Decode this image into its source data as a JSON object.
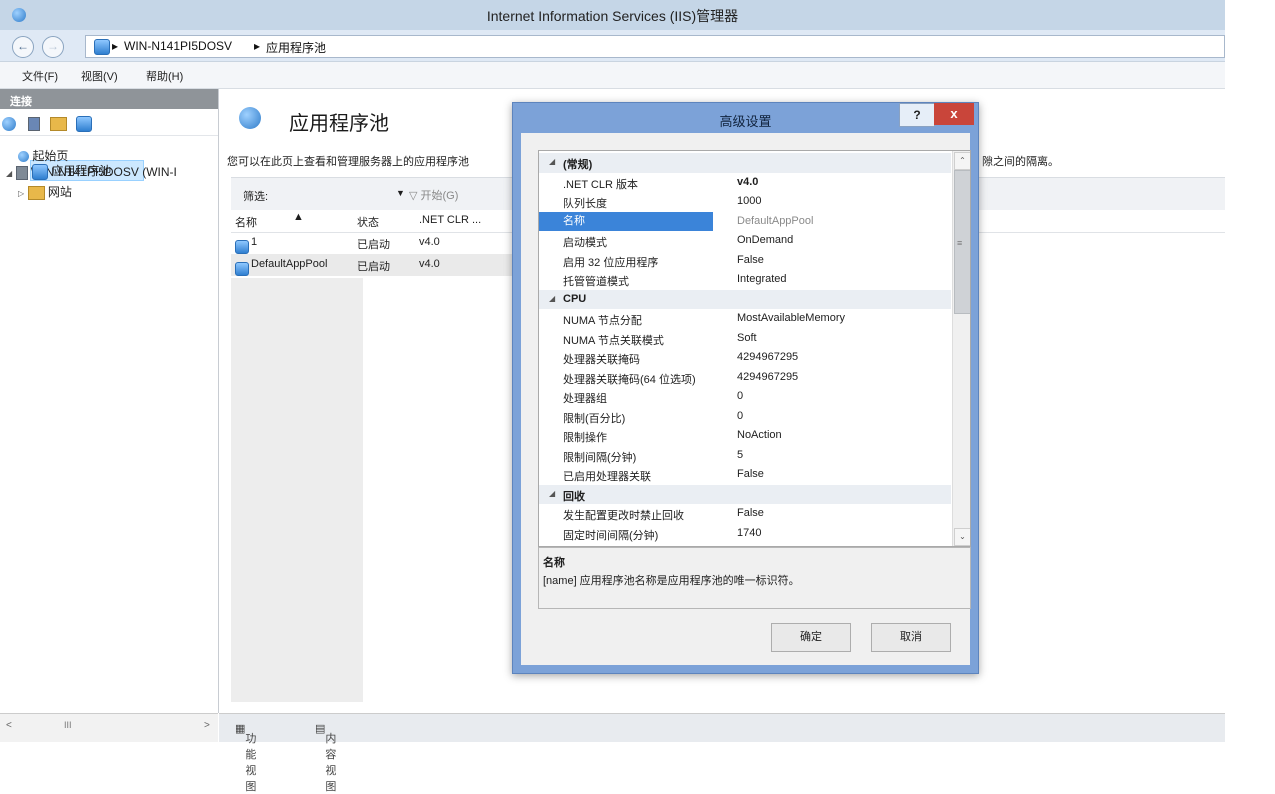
{
  "window": {
    "title": "Internet Information Services (IIS)管理器"
  },
  "address": {
    "items": [
      "WIN-N141PI5DOSV",
      "应用程序池"
    ]
  },
  "menu": {
    "items": [
      "文件(F)",
      "视图(V)",
      "帮助(H)"
    ]
  },
  "connections": {
    "header": "连接",
    "tree": {
      "start": "起始页",
      "server": "WIN-N141PI5DOSV (WIN-I",
      "app_pools": "应用程序池",
      "sites": "网站"
    }
  },
  "center": {
    "title": "应用程序池",
    "description": "您可以在此页上查看和管理服务器上的应用程序池",
    "description_tail": "隙之间的隔离。",
    "filter_label": "筛选:",
    "start_label": "开始(G)",
    "columns": [
      "名称",
      "状态",
      ".NET CLR ..."
    ],
    "rows": [
      {
        "name": "1",
        "status": "已启动",
        "clr": "v4.0"
      },
      {
        "name": "DefaultAppPool",
        "status": "已启动",
        "clr": "v4.0"
      }
    ]
  },
  "bottom": {
    "feature_view": "功能视图",
    "content_view": "内容视图"
  },
  "dialog": {
    "title": "高级设置",
    "help": "?",
    "close": "x",
    "categories": {
      "general": "(常规)",
      "cpu": "CPU",
      "recycling": "回收"
    },
    "general_props": [
      {
        "name": ".NET CLR 版本",
        "value": "v4.0"
      },
      {
        "name": "队列长度",
        "value": "1000"
      },
      {
        "name": "名称",
        "value": "DefaultAppPool"
      },
      {
        "name": "启动模式",
        "value": "OnDemand"
      },
      {
        "name": "启用 32 位应用程序",
        "value": "False"
      },
      {
        "name": "托管管道模式",
        "value": "Integrated"
      }
    ],
    "cpu_props": [
      {
        "name": "NUMA 节点分配",
        "value": "MostAvailableMemory"
      },
      {
        "name": "NUMA 节点关联模式",
        "value": "Soft"
      },
      {
        "name": "处理器关联掩码",
        "value": "4294967295"
      },
      {
        "name": "处理器关联掩码(64 位选项)",
        "value": "4294967295"
      },
      {
        "name": "处理器组",
        "value": "0"
      },
      {
        "name": "限制(百分比)",
        "value": "0"
      },
      {
        "name": "限制操作",
        "value": "NoAction"
      },
      {
        "name": "限制间隔(分钟)",
        "value": "5"
      },
      {
        "name": "已启用处理器关联",
        "value": "False"
      }
    ],
    "recycle_props": [
      {
        "name": "发生配置更改时禁止回收",
        "value": "False"
      },
      {
        "name": "固定时间间隔(分钟)",
        "value": "1740"
      }
    ],
    "desc_title": "名称",
    "desc_text": "[name] 应用程序池名称是应用程序池的唯一标识符。",
    "ok": "确定",
    "cancel": "取消"
  }
}
